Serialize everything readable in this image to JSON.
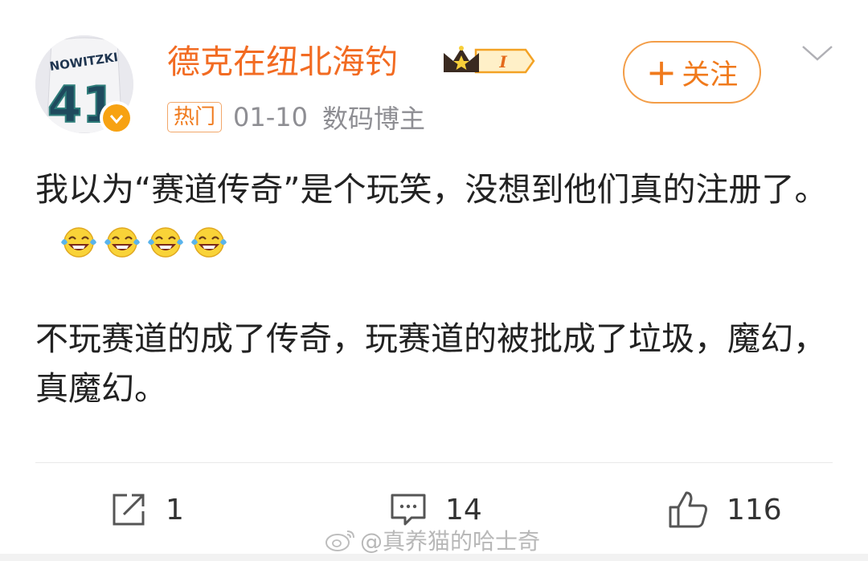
{
  "user": {
    "name": "德克在纽北海钓",
    "avatar_jersey_name": "NOWITZKI",
    "avatar_jersey_number": "41",
    "crown_badge_label": "I"
  },
  "follow_button": {
    "label": "关注"
  },
  "meta": {
    "tag": "热门",
    "time": "01-10",
    "source": "数码博主"
  },
  "post": {
    "paragraph1": "我以为“赛道传奇”是个玩笑，没想到他们真的注册了。",
    "emoji_icons": [
      "laughing-tears-icon",
      "laughing-tears-icon",
      "laughing-tears-icon",
      "laughing-tears-icon"
    ],
    "paragraph2": "不玩赛道的成了传奇，玩赛道的被批成了垃圾，魔幻，真魔幻。"
  },
  "actions": {
    "repost_count": "1",
    "comment_count": "14",
    "like_count": "116"
  },
  "watermark": "@真养猫的哈士奇",
  "colors": {
    "accent": "#f26b22",
    "follow_border": "#f39d47",
    "meta_gray": "#8e8e93"
  }
}
